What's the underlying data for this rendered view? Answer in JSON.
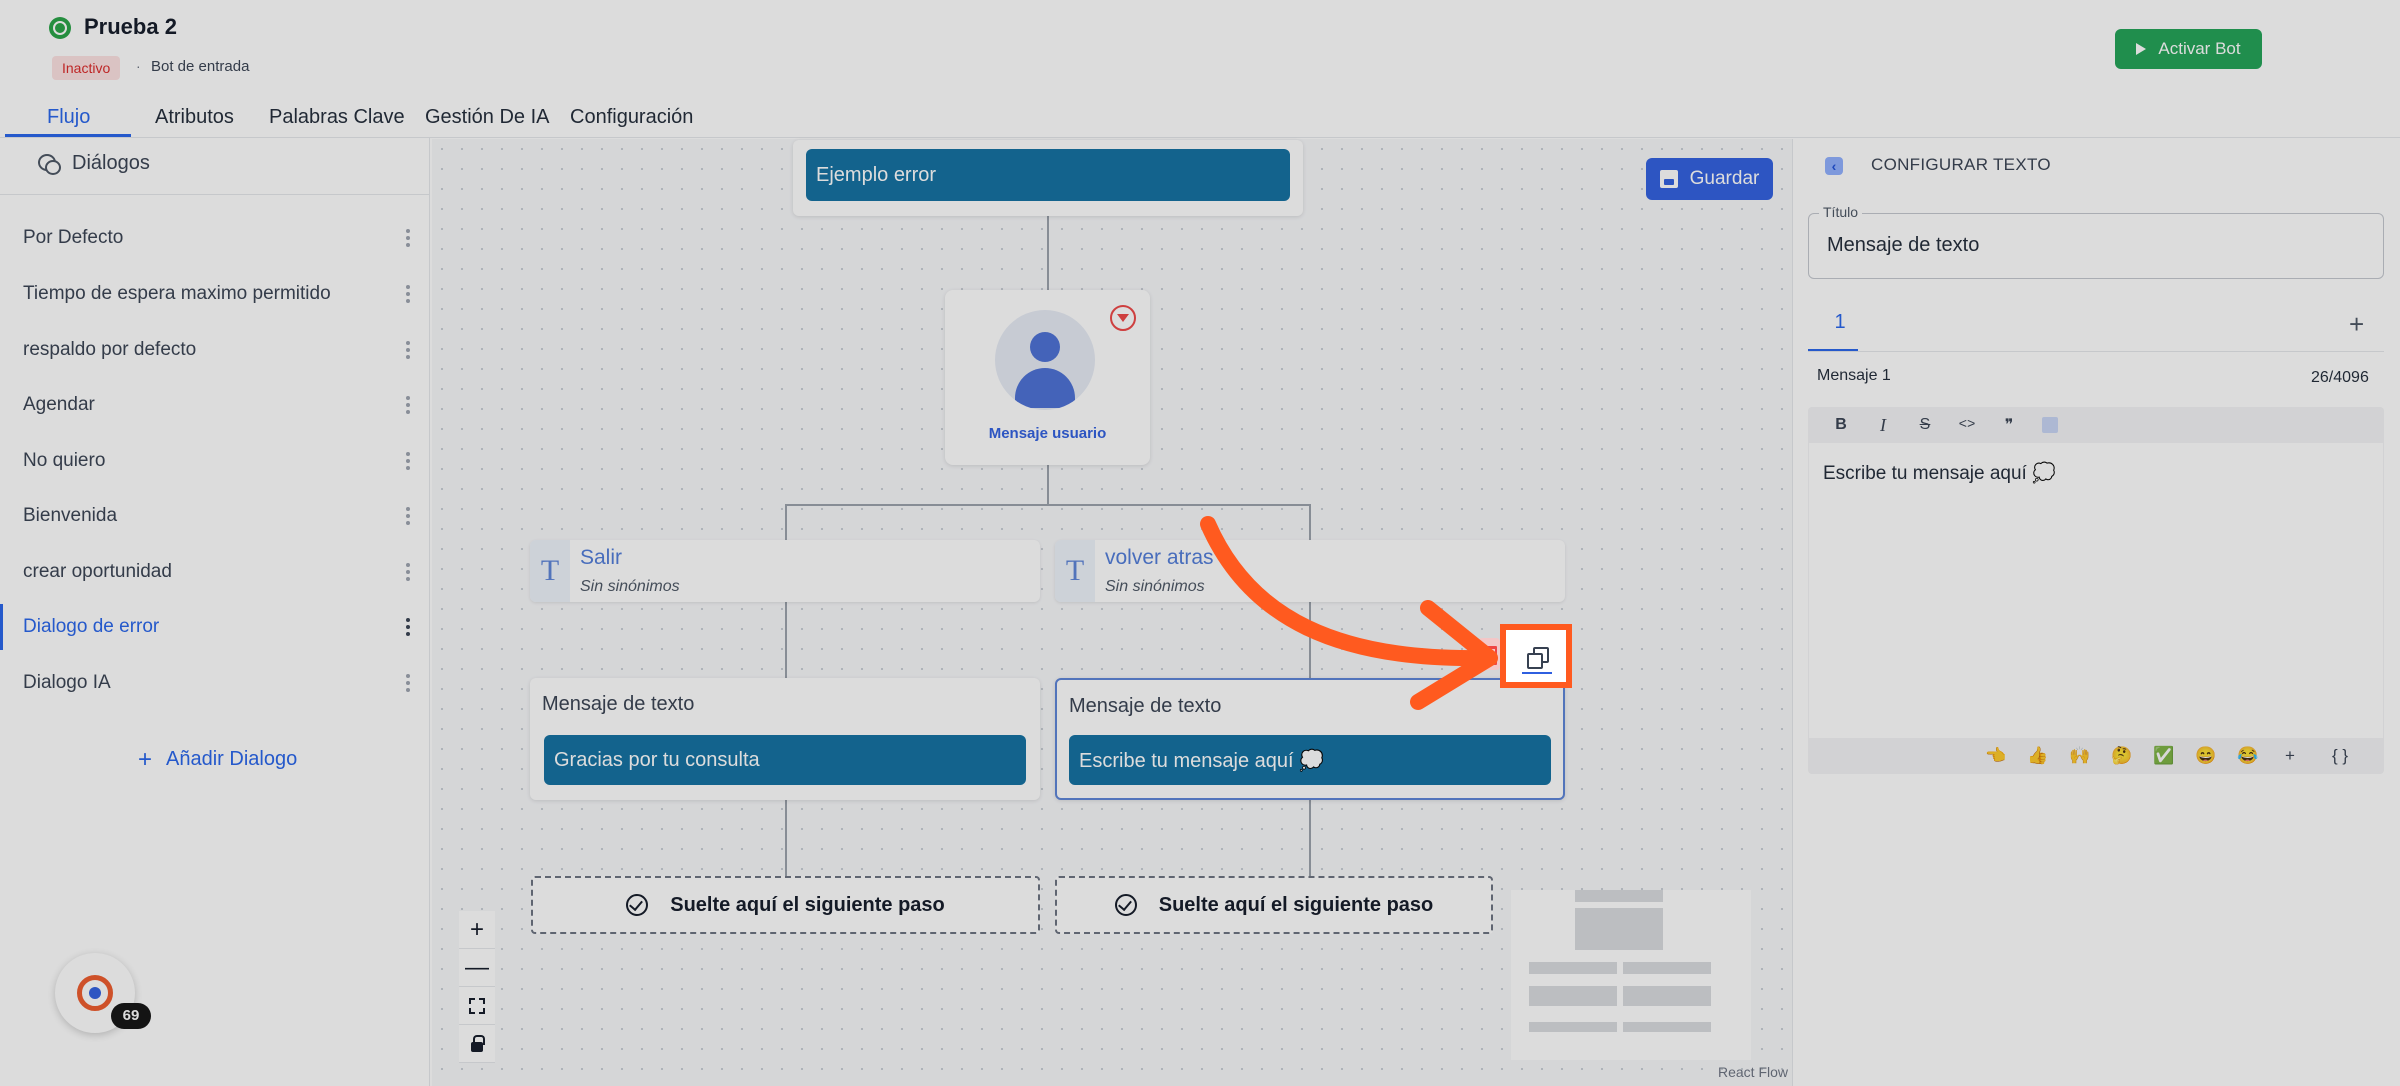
{
  "header": {
    "title": "Prueba 2",
    "status": "Inactivo",
    "separator": "·",
    "bot_type": "Bot de entrada",
    "activate_label": "Activar Bot"
  },
  "tabs": [
    {
      "label": "Flujo"
    },
    {
      "label": "Atributos"
    },
    {
      "label": "Palabras Clave"
    },
    {
      "label": "Gestión De IA"
    },
    {
      "label": "Configuración"
    }
  ],
  "sidebar": {
    "heading": "Diálogos",
    "items": [
      {
        "label": "Por Defecto"
      },
      {
        "label": "Tiempo de espera maximo permitido"
      },
      {
        "label": "respaldo por defecto"
      },
      {
        "label": "Agendar"
      },
      {
        "label": "No quiero"
      },
      {
        "label": "Bienvenida"
      },
      {
        "label": "crear oportunidad"
      },
      {
        "label": "Dialogo de error"
      },
      {
        "label": "Dialogo IA"
      }
    ],
    "add_label": "Añadir Dialogo"
  },
  "canvas": {
    "save_label": "Guardar",
    "root_node_label": "Ejemplo error",
    "user_node_label": "Mensaje usuario",
    "keywords": [
      {
        "title": "Salir",
        "subtitle": "Sin sinónimos"
      },
      {
        "title": "volver atras",
        "subtitle": "Sin sinónimos"
      }
    ],
    "text_nodes": [
      {
        "title": "Mensaje de texto",
        "message": "Gracias por tu consulta"
      },
      {
        "title": "Mensaje de texto",
        "message": "Escribe tu mensaje aquí 💭"
      }
    ],
    "drop_zone_label": "Suelte aquí el siguiente paso",
    "zoom_in": "+",
    "zoom_out": "—",
    "attribution": "React Flow"
  },
  "panel": {
    "heading": "CONFIGURAR TEXTO",
    "title_legend": "Título",
    "title_value": "Mensaje de texto",
    "active_message_tab": "1",
    "add_tab": "+",
    "message_label": "Mensaje 1",
    "char_count": "26/4096",
    "toolbar": [
      "B",
      "I",
      "S",
      "<>",
      "❞"
    ],
    "editor_text": "Escribe tu mensaje aquí 💭",
    "emojis": [
      "👈",
      "👍",
      "🙌",
      "🤔",
      "✅",
      "😄",
      "😂"
    ],
    "emoji_add": "+",
    "braces": "{ }"
  },
  "help_widget": {
    "count": "69"
  },
  "colors": {
    "accent": "#2563eb",
    "node_fill": "#106fa1",
    "activate": "#1fa355",
    "highlight": "#ff5a1f"
  }
}
